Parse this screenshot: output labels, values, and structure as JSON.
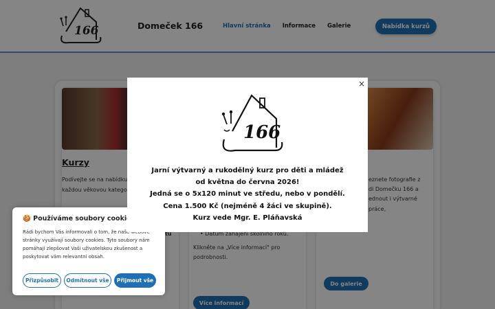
{
  "header": {
    "site_title": "Domeček 166",
    "nav": [
      {
        "label": "Hlavní stránka",
        "active": true
      },
      {
        "label": "Informace",
        "active": false
      },
      {
        "label": "Galerie",
        "active": false
      }
    ],
    "cta_label": "Nabídka kurzů",
    "logo_text": "166"
  },
  "cards": [
    {
      "title": "Kurzy",
      "text_lines": [
        "Podívejte se na nabídku",
        "každou věkovou katego"
      ],
      "extra": "tu"
    },
    {
      "list_item": "Datum zahájení školního roku.",
      "text_lines": [
        "Klikněte na „Více informací\" pro",
        "podrobnosti."
      ],
      "button_label": "Více informací"
    },
    {
      "text_lines": [
        "eznete fotografie z",
        "di Domečku 166 a",
        "ednout i výtvarné práce,",
        "."
      ],
      "button_label": "Do galerie"
    }
  ],
  "cookie": {
    "title": "🍪 Používáme soubory cookies",
    "text": "Rádi bychom Vás informovali o tom, že naše webové stránky využívají soubory cookies. Tyto soubory nám pomáhají zlepšovat Vaši uživatelskou zkušenost a poskytovat vám relevantní obsah.",
    "buttons": {
      "preferences": "Přizpůsobit",
      "reject": "Odmítnout vše",
      "accept": "Přijmout vše"
    }
  },
  "modal": {
    "close_label": "×",
    "logo_text": "166",
    "lines": [
      "Jarní výtvarný a rukodělný kurz pro děti a mládež",
      "od května do června 2026!",
      "Jedná se o 5x120 minut ve středu, nebo v pondělí.",
      "Cena 1.500 Kč (nejméně 4 žáci ve skupině).",
      "Kurz vede Mgr. E. Pláňavská"
    ]
  },
  "colors": {
    "accent": "#1f6fb5",
    "overlay": "rgba(0,0,0,0.48)"
  }
}
